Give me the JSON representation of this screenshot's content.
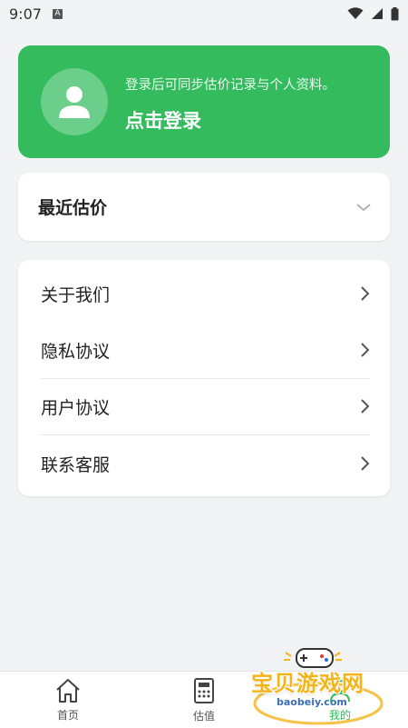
{
  "status_bar": {
    "time": "9:07",
    "notice_icon_letter": "A"
  },
  "login_card": {
    "hint": "登录后可同步估价记录与个人资料。",
    "action": "点击登录",
    "color": "#33bb5d"
  },
  "recent": {
    "title": "最近估价"
  },
  "menu": {
    "items": [
      {
        "label": "关于我们"
      },
      {
        "label": "隐私协议"
      },
      {
        "label": "用户协议"
      },
      {
        "label": "联系客服"
      }
    ]
  },
  "tabs": [
    {
      "label": "首页",
      "icon": "home-icon"
    },
    {
      "label": "估值",
      "icon": "calculator-icon"
    },
    {
      "label": "我的",
      "icon": "profile-icon",
      "active": true
    }
  ],
  "watermark": {
    "title": "宝贝游戏网",
    "url": "baobeiy.com"
  },
  "colors": {
    "accent": "#33bb5d",
    "background": "#f2f3f5"
  }
}
